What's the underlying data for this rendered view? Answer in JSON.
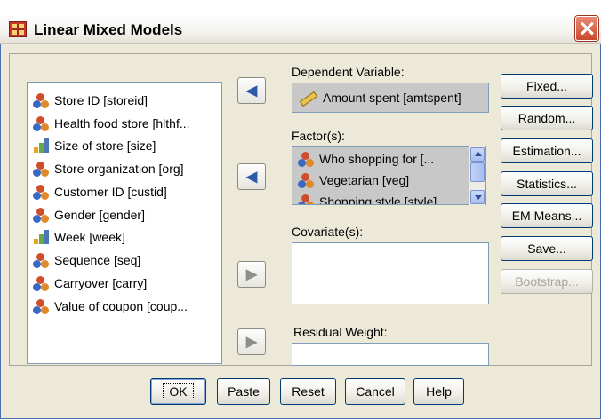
{
  "window": {
    "title": "Linear Mixed Models"
  },
  "variables": [
    {
      "label": "Store ID [storeid]",
      "icon": "nominal-icon"
    },
    {
      "label": "Health food store [hlthf...",
      "icon": "nominal-icon"
    },
    {
      "label": "Size of store [size]",
      "icon": "scale-icon"
    },
    {
      "label": "Store organization [org]",
      "icon": "nominal-icon"
    },
    {
      "label": "Customer ID [custid]",
      "icon": "nominal-icon"
    },
    {
      "label": "Gender [gender]",
      "icon": "nominal-icon"
    },
    {
      "label": "Week [week]",
      "icon": "scale-icon"
    },
    {
      "label": "Sequence [seq]",
      "icon": "nominal-icon"
    },
    {
      "label": "Carryover [carry]",
      "icon": "nominal-icon"
    },
    {
      "label": "Value of coupon [coup...",
      "icon": "nominal-icon"
    }
  ],
  "dependent": {
    "label": "Dependent Variable:",
    "value": "Amount spent [amtspent]"
  },
  "factors": {
    "label": "Factor(s):",
    "items": [
      "Who shopping for [...",
      "Vegetarian [veg]",
      "Shopping style [style]"
    ]
  },
  "covariates": {
    "label": "Covariate(s):"
  },
  "residual_weight": {
    "label": "Residual Weight:"
  },
  "side_buttons": {
    "fixed": "Fixed...",
    "random": "Random...",
    "estimation": "Estimation...",
    "statistics": "Statistics...",
    "em_means": "EM Means...",
    "save": "Save...",
    "bootstrap": "Bootstrap..."
  },
  "bottom_buttons": {
    "ok": "OK",
    "paste": "Paste",
    "reset": "Reset",
    "cancel": "Cancel",
    "help": "Help"
  }
}
